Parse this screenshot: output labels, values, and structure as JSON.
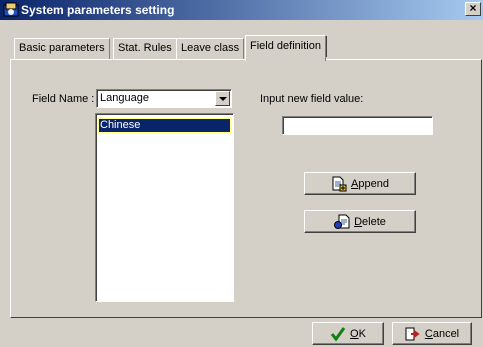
{
  "window": {
    "title": "System parameters setting",
    "close_label": "×"
  },
  "tabs": [
    {
      "label": "Basic parameters",
      "active": false
    },
    {
      "label": "Stat. Rules",
      "active": false
    },
    {
      "label": "Leave class",
      "active": false
    },
    {
      "label": "Field definition",
      "active": true
    }
  ],
  "field_name": {
    "label": "Field Name :",
    "value": "Language"
  },
  "value_list": {
    "items": [
      "Chinese"
    ],
    "selected": "Chinese"
  },
  "new_value": {
    "label": "Input new field value:",
    "value": ""
  },
  "buttons": {
    "append": {
      "label_pre": "",
      "label_u": "A",
      "label_post": "ppend"
    },
    "delete": {
      "label_pre": "",
      "label_u": "D",
      "label_post": "elete"
    },
    "ok": {
      "label_pre": "",
      "label_u": "O",
      "label_post": "K"
    },
    "cancel": {
      "label_pre": "",
      "label_u": "C",
      "label_post": "ancel"
    }
  },
  "icons": {
    "app": "app-icon",
    "append": "append-document-icon",
    "delete": "delete-document-icon",
    "ok": "checkmark-icon",
    "cancel": "exit-arrow-icon"
  },
  "colors": {
    "titlebar_start": "#0a246a",
    "titlebar_end": "#a6caf0",
    "face": "#d4d0c8",
    "selection": "#0a246a"
  }
}
